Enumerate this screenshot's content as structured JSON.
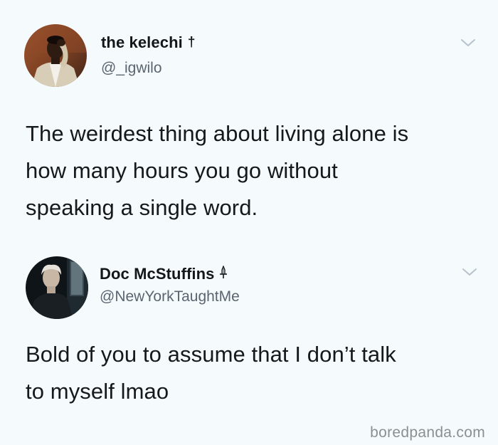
{
  "tweets": [
    {
      "display_name": "the kelechi",
      "name_badge": "†",
      "handle": "@_igwilo",
      "text": "The weirdest thing about living alone is\nhow many hours you go without\nspeaking a single word.",
      "avatar_icon": "user-photo-avatar",
      "menu_icon": "chevron-down-icon"
    },
    {
      "display_name": "Doc McStuffins",
      "name_badge": "🗡",
      "handle": "@NewYorkTaughtMe",
      "text": "Bold of you to assume that I don’t talk\nto myself lmao",
      "avatar_icon": "user-photo-avatar",
      "menu_icon": "chevron-down-icon"
    }
  ],
  "watermark": "boredpanda.com",
  "colors": {
    "background": "#f5fbfd",
    "text": "#15181c",
    "secondary_text": "#5b6570",
    "chevron": "#b8c2cc",
    "watermark": "#8a8f94"
  }
}
